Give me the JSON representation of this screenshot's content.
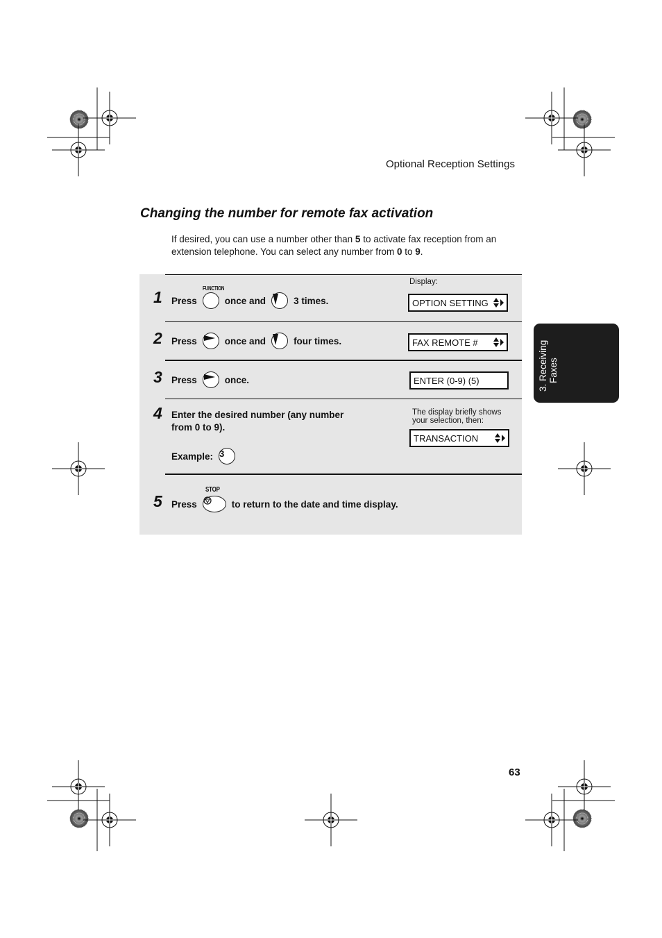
{
  "header": {
    "running_title": "Optional Reception Settings"
  },
  "section": {
    "title": "Changing the number for remote fax activation",
    "intro": {
      "part1": "If desired, you can use a number other than ",
      "bold1": "5",
      "part2": " to activate fax reception from an extension telephone. You can select any number from ",
      "bold2": "0",
      "part3": " to ",
      "bold3": "9",
      "part4": "."
    }
  },
  "display_label": "Display:",
  "steps": [
    {
      "number": "1",
      "press": "Press",
      "key1_label": "FUNCTION",
      "key1_icon": "function-key",
      "mid": "once and",
      "key2_icon": "down-arrow-key",
      "end": "3 times.",
      "display": "OPTION SETTING",
      "display_icon": "up-down-right-arrows"
    },
    {
      "number": "2",
      "press": "Press",
      "key1_icon": "right-arrow-key",
      "mid": "once and",
      "key2_icon": "down-arrow-key",
      "end": "four times.",
      "display": "FAX REMOTE #",
      "display_icon": "up-down-right-arrows"
    },
    {
      "number": "3",
      "press": "Press",
      "key1_icon": "right-arrow-key",
      "end": "once.",
      "display": "ENTER (0-9) (5)"
    },
    {
      "number": "4",
      "line1": "Enter the desired number (any number",
      "line2": "from 0 to 9).",
      "example_label": "Example:",
      "example_key": "3",
      "note_line1": "The display briefly shows",
      "note_line2": "your selection, then:",
      "display": "TRANSACTION",
      "display_icon": "up-down-right-arrows"
    },
    {
      "number": "5",
      "press": "Press",
      "key1_label": "STOP",
      "key1_icon": "stop-key",
      "end": "to return to the date and time display."
    }
  ],
  "side_tab": {
    "line1": "3. Receiving",
    "line2": "Faxes"
  },
  "page_number": "63"
}
